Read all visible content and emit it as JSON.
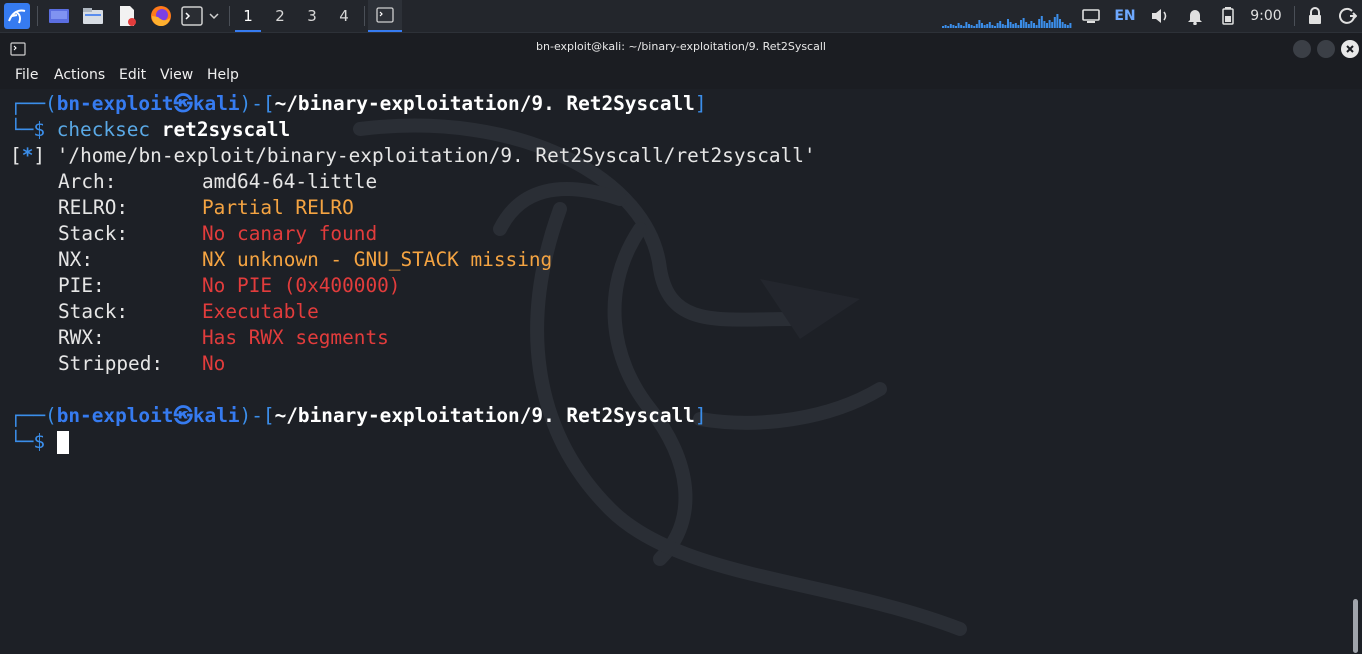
{
  "panel": {
    "workspaces": [
      "1",
      "2",
      "3",
      "4"
    ],
    "language": "EN",
    "clock": "9:00",
    "icons": [
      "kali-menu-icon",
      "desktop-icon",
      "files-icon",
      "text-editor-icon",
      "firefox-icon",
      "terminal-icon",
      "dropdown-chevron-icon",
      "terminal-window-icon",
      "cpu-graph-icon",
      "screen-icon",
      "volume-icon",
      "notification-bell-icon",
      "battery-icon",
      "lock-icon",
      "logout-icon"
    ]
  },
  "window": {
    "title": "bn-exploit@kali: ~/binary-exploitation/9. Ret2Syscall",
    "menu": [
      "File",
      "Actions",
      "Edit",
      "View",
      "Help"
    ]
  },
  "terminal": {
    "prompt": {
      "open": "┌──(",
      "user": "bn-exploit",
      "at": "㉿",
      "host": "kali",
      "mid": ")-[",
      "cwd": "~/binary-exploitation/9. Ret2Syscall",
      "close": "]",
      "second": "└─$ "
    },
    "command": "checksec",
    "argument": "ret2syscall",
    "info_prefix": "[*]",
    "file": "'/home/bn-exploit/binary-exploitation/9. Ret2Syscall/ret2syscall'",
    "rows": [
      {
        "label": "Arch:",
        "value": "amd64-64-little",
        "color": "#e6e6e6"
      },
      {
        "label": "RELRO:",
        "value": "Partial RELRO",
        "color": "#f5a442"
      },
      {
        "label": "Stack:",
        "value": "No canary found",
        "color": "#e23c3c"
      },
      {
        "label": "NX:",
        "value": "NX unknown - GNU_STACK missing",
        "color": "#f5a442"
      },
      {
        "label": "PIE:",
        "value": "No PIE (0x400000)",
        "color": "#e23c3c"
      },
      {
        "label": "Stack:",
        "value": "Executable",
        "color": "#e23c3c"
      },
      {
        "label": "RWX:",
        "value": "Has RWX segments",
        "color": "#e23c3c"
      },
      {
        "label": "Stripped:",
        "value": "No",
        "color": "#e23c3c"
      }
    ]
  }
}
